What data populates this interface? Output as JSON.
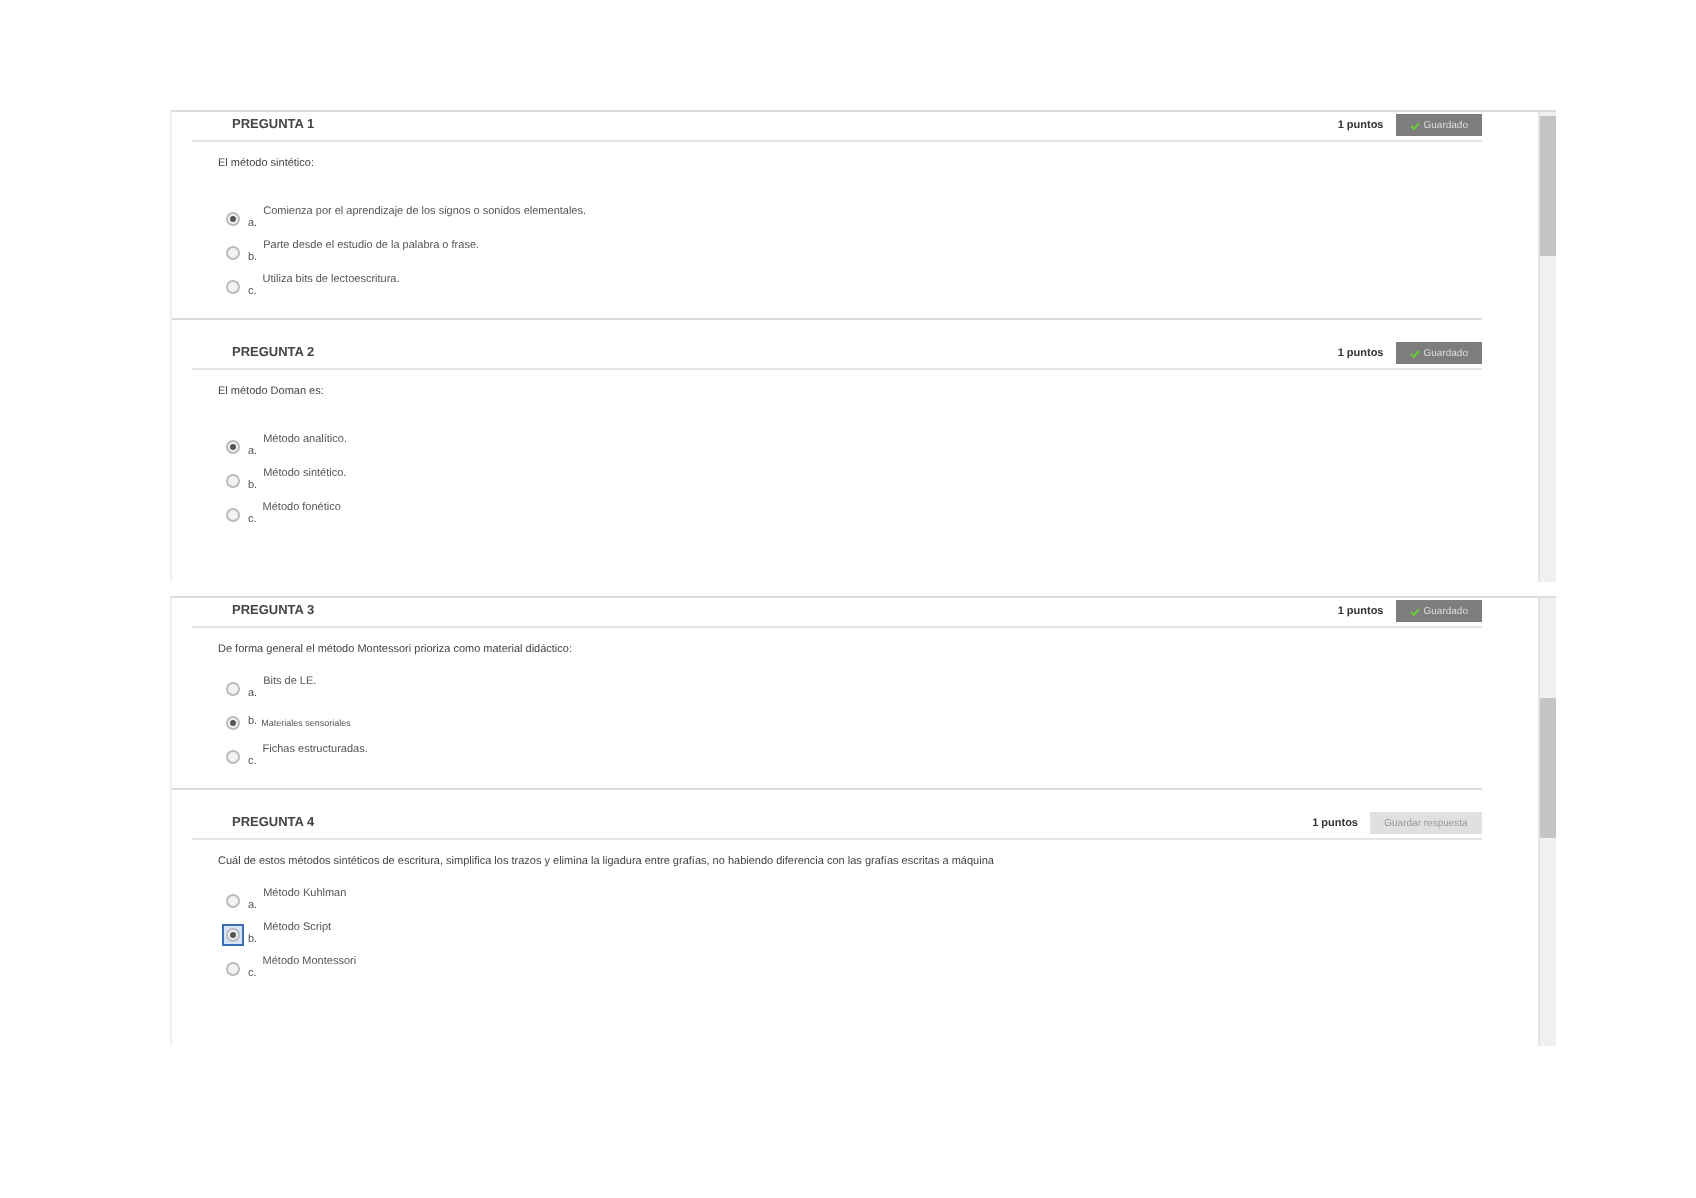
{
  "panels": [
    {
      "questions": [
        {
          "title": "PREGUNTA 1",
          "points": "1 puntos",
          "status": {
            "kind": "saved",
            "label": "Guardado"
          },
          "prompt": "El método sintético:",
          "options": [
            {
              "letter": "a.",
              "text": "Comienza por el aprendizaje de los signos o sonidos elementales.",
              "selected": true,
              "focused": false,
              "kind": "raised"
            },
            {
              "letter": "b.",
              "text": "Parte desde el estudio de la palabra o frase.",
              "selected": false,
              "focused": false,
              "kind": "raised"
            },
            {
              "letter": "c.",
              "text": "Utiliza bits de lectoescritura.",
              "selected": false,
              "focused": false,
              "kind": "raised"
            }
          ]
        },
        {
          "title": "PREGUNTA 2",
          "points": "1 puntos",
          "status": {
            "kind": "saved",
            "label": "Guardado"
          },
          "prompt": "El método Doman es:",
          "options": [
            {
              "letter": "a.",
              "text": "Método analítico.",
              "selected": true,
              "focused": false,
              "kind": "raised"
            },
            {
              "letter": "b.",
              "text": "Método sintético.",
              "selected": false,
              "focused": false,
              "kind": "raised"
            },
            {
              "letter": "c.",
              "text": "Método fonético",
              "selected": false,
              "focused": false,
              "kind": "raised"
            }
          ]
        }
      ]
    },
    {
      "questions": [
        {
          "title": "PREGUNTA 3",
          "points": "1 puntos",
          "status": {
            "kind": "saved",
            "label": "Guardado"
          },
          "prompt": "De forma general el método Montessori prioriza  como material didáctico:",
          "options": [
            {
              "letter": "a.",
              "text": "Bits de LE.",
              "selected": false,
              "focused": false,
              "kind": "raised"
            },
            {
              "letter": "b.",
              "text": "Materiales sensoriales",
              "selected": true,
              "focused": false,
              "kind": "inline"
            },
            {
              "letter": "c.",
              "text": "Fichas estructuradas.",
              "selected": false,
              "focused": false,
              "kind": "raised"
            }
          ]
        },
        {
          "title": "PREGUNTA 4",
          "points": "1 puntos",
          "status": {
            "kind": "save",
            "label": "Guardar respuesta"
          },
          "prompt": "Cuál de estos métodos sintéticos de escritura, simplifica los trazos y elimina la ligadura entre grafías, no habiendo diferencia con las grafías escritas a máquina",
          "options": [
            {
              "letter": "a.",
              "text": "Método Kuhlman",
              "selected": false,
              "focused": false,
              "kind": "raised"
            },
            {
              "letter": "b.",
              "text": "Método Script",
              "selected": true,
              "focused": true,
              "kind": "raised"
            },
            {
              "letter": "c.",
              "text": "Método Montessori",
              "selected": false,
              "focused": false,
              "kind": "raised"
            }
          ]
        }
      ]
    }
  ]
}
